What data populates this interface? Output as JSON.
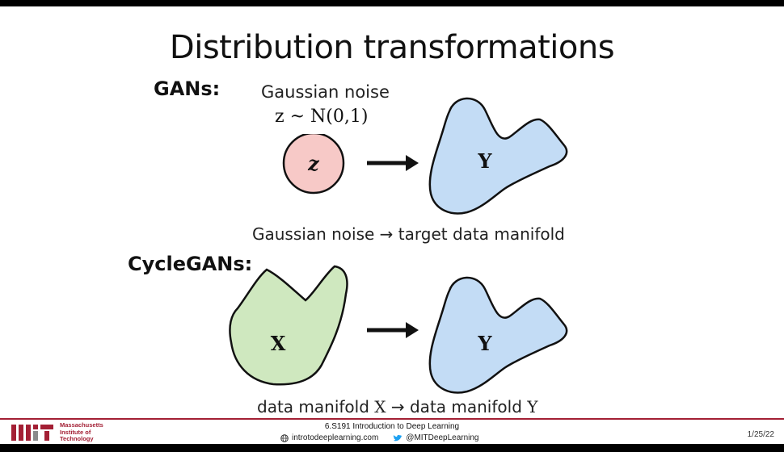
{
  "slide": {
    "title": "Distribution transformations",
    "gans": {
      "label": "GANs:",
      "noise_label": "Gaussian noise",
      "noise_formula": "z ~ N(0,1)",
      "source_symbol": "z",
      "target_symbol": "Y",
      "caption": "Gaussian noise → target data manifold"
    },
    "cyclegans": {
      "label": "CycleGANs:",
      "source_symbol": "X",
      "target_symbol": "Y",
      "caption_prefix": "data manifold ",
      "caption_x": "X",
      "caption_mid": " → data manifold ",
      "caption_y": "Y"
    }
  },
  "footer": {
    "institute_line1": "Massachusetts",
    "institute_line2": "Institute of",
    "institute_line3": "Technology",
    "course": "6.S191 Introduction to Deep Learning",
    "website": "introtodeeplearning.com",
    "twitter": "@MITDeepLearning",
    "date": "1/25/22"
  },
  "colors": {
    "noise_fill": "#f7c9c7",
    "data_y_fill": "#c3dcf5",
    "data_x_fill": "#cfe8bf",
    "mit_red": "#a31f34"
  },
  "icons": [
    "right-arrow-icon",
    "globe-icon",
    "twitter-icon",
    "mit-logo"
  ]
}
